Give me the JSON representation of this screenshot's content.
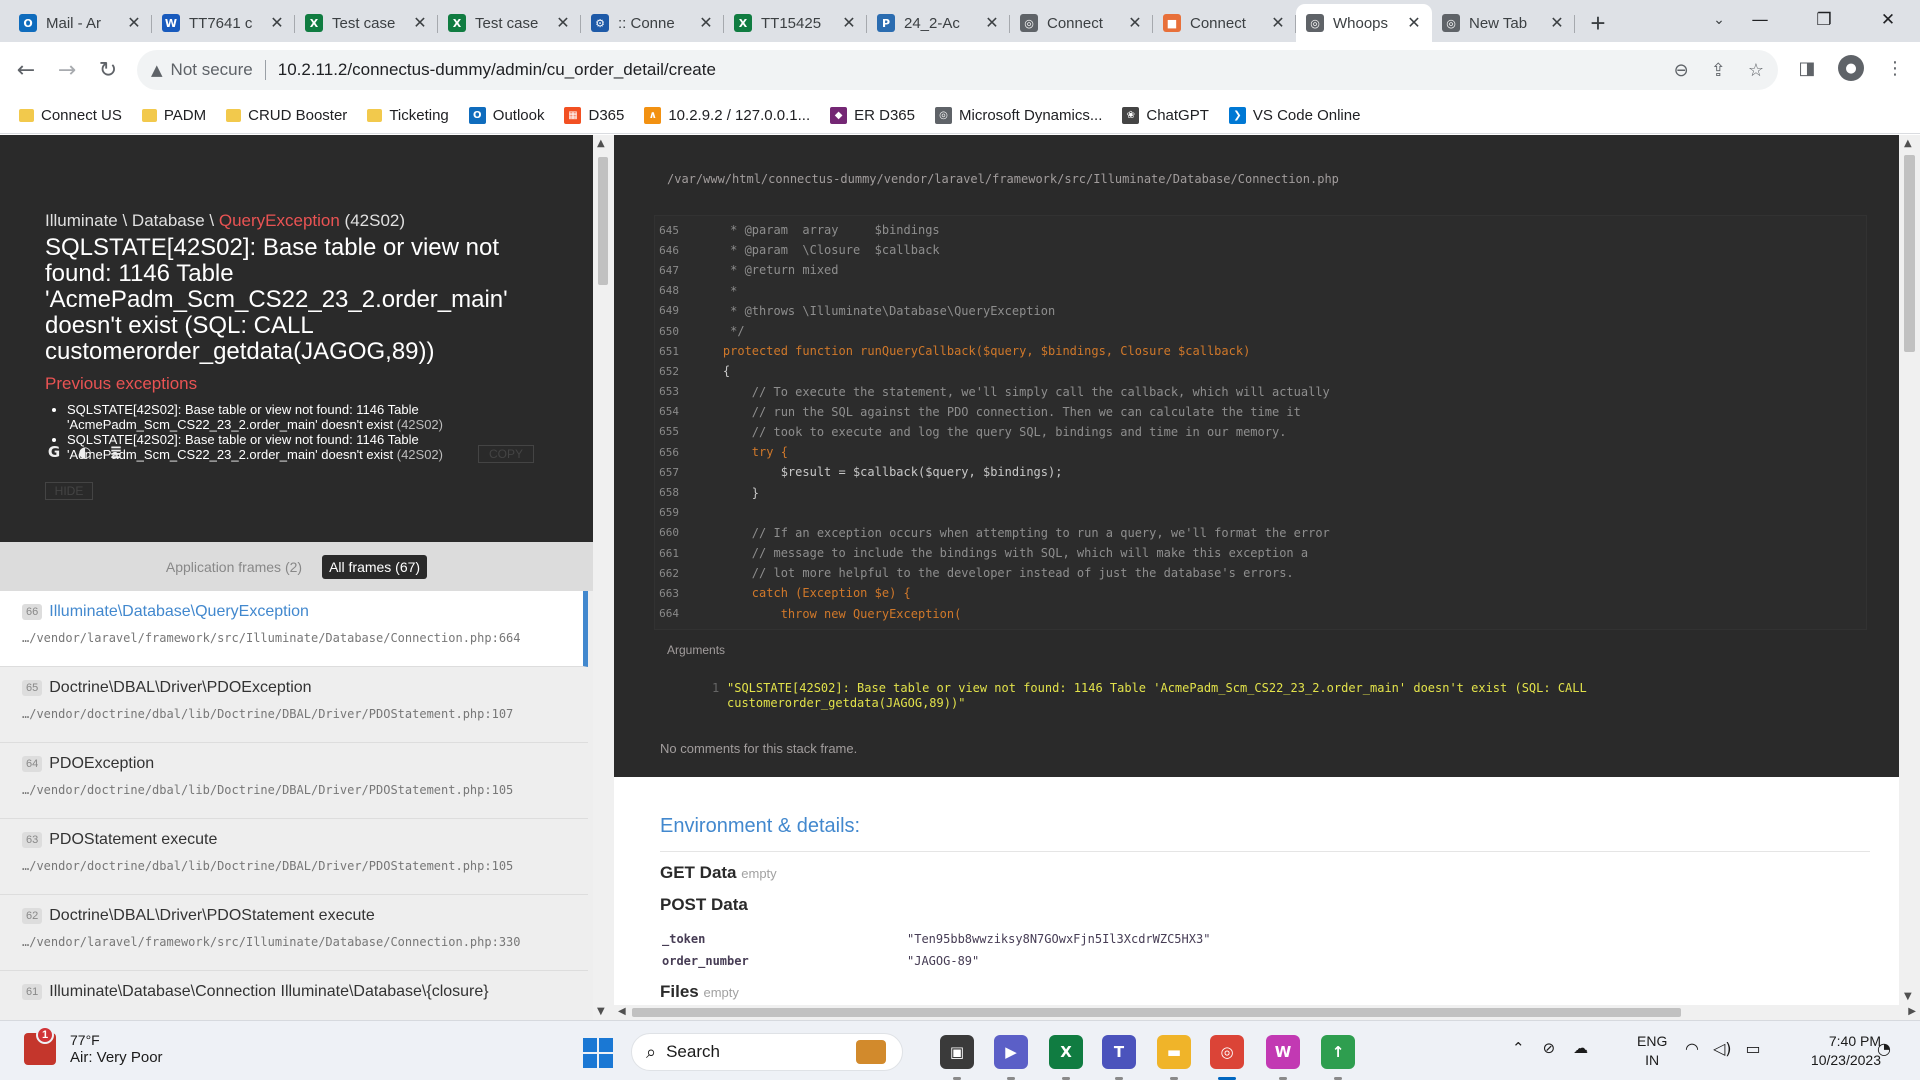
{
  "browser": {
    "tabs": [
      {
        "title": "Mail - Ar",
        "icon": "outlook-icon",
        "color": "#0f6cbd",
        "glyph": "O"
      },
      {
        "title": "TT7641 c",
        "icon": "word-icon",
        "color": "#185abd",
        "glyph": "W"
      },
      {
        "title": "Test case",
        "icon": "excel-icon",
        "color": "#107c41",
        "glyph": "X"
      },
      {
        "title": "Test case",
        "icon": "excel-icon",
        "color": "#107c41",
        "glyph": "X"
      },
      {
        "title": ":: Conne",
        "icon": "settings-icon",
        "color": "#1e5aa8",
        "glyph": "⚙"
      },
      {
        "title": "TT15425",
        "icon": "excel-icon",
        "color": "#107c41",
        "glyph": "X"
      },
      {
        "title": "24_2-Ac",
        "icon": "project-icon",
        "color": "#2b6cb0",
        "glyph": "P"
      },
      {
        "title": "Connect",
        "icon": "globe-icon",
        "color": "#5f6368",
        "glyph": "◎"
      },
      {
        "title": "Connect",
        "icon": "page-icon",
        "color": "#e8703a",
        "glyph": "■"
      },
      {
        "title": "Whoops",
        "icon": "globe-icon",
        "color": "#5f6368",
        "glyph": "◎",
        "active": true
      },
      {
        "title": "New Tab",
        "icon": "chrome-icon",
        "color": "#5f6368",
        "glyph": "◎"
      }
    ],
    "address": {
      "security": "Not secure",
      "url": "10.2.11.2/connectus-dummy/admin/cu_order_detail/create"
    },
    "bookmarks": [
      {
        "label": "Connect US",
        "type": "folder"
      },
      {
        "label": "PADM",
        "type": "folder"
      },
      {
        "label": "CRUD Booster",
        "type": "folder"
      },
      {
        "label": "Ticketing",
        "type": "folder"
      },
      {
        "label": "Outlook",
        "type": "outlook",
        "color": "#0f6cbd",
        "glyph": "O"
      },
      {
        "label": "D365",
        "type": "ms",
        "color": "#f25022",
        "glyph": "▦"
      },
      {
        "label": "10.2.9.2 / 127.0.0.1...",
        "type": "pma",
        "color": "#f29111",
        "glyph": "∧"
      },
      {
        "label": "ER D365",
        "type": "power",
        "color": "#742774",
        "glyph": "◆"
      },
      {
        "label": "Microsoft Dynamics...",
        "type": "globe",
        "color": "#5f6368",
        "glyph": "◎"
      },
      {
        "label": "ChatGPT",
        "type": "chatgpt",
        "color": "#444444",
        "glyph": "❀"
      },
      {
        "label": "VS Code Online",
        "type": "vscode",
        "color": "#0078d4",
        "glyph": "❯"
      }
    ]
  },
  "exception": {
    "namespace": "Illuminate \\ Database \\ ",
    "class": "QueryException",
    "code": " (42S02)",
    "message": "SQLSTATE[42S02]: Base table or view not found: 1146 Table 'AcmePadm_Scm_CS22_23_2.order_main' doesn't exist (SQL: CALL customerorder_getdata(JAGOG,89))",
    "previous_title": "Previous exceptions",
    "previous": [
      {
        "text": "SQLSTATE[42S02]: Base table or view not found: 1146 Table 'AcmePadm_Scm_CS22_23_2.order_main' doesn't exist ",
        "code": "(42S02)"
      },
      {
        "text": "SQLSTATE[42S02]: Base table or view not found: 1146 Table 'AcmePadm_Scm_CS22_23_2.order_main' doesn't exist ",
        "code": "(42S02)"
      }
    ],
    "copy_label": "COPY",
    "hide_label": "HIDE"
  },
  "frames_filter": {
    "application": "Application frames (2)",
    "all": "All frames (67)"
  },
  "frames": [
    {
      "index": "66",
      "class": "Illuminate\\Database\\QueryException",
      "file": "…/vendor/laravel/framework/src/Illuminate/Database/Connection.php:664",
      "active": true
    },
    {
      "index": "65",
      "class": "Doctrine\\DBAL\\Driver\\PDOException",
      "file": "…/vendor/doctrine/dbal/lib/Doctrine/DBAL/Driver/PDOStatement.php:107"
    },
    {
      "index": "64",
      "class": "PDOException",
      "file": "…/vendor/doctrine/dbal/lib/Doctrine/DBAL/Driver/PDOStatement.php:105"
    },
    {
      "index": "63",
      "class": "PDOStatement execute",
      "file": "…/vendor/doctrine/dbal/lib/Doctrine/DBAL/Driver/PDOStatement.php:105"
    },
    {
      "index": "62",
      "class": "Doctrine\\DBAL\\Driver\\PDOStatement execute",
      "file": "…/vendor/laravel/framework/src/Illuminate/Database/Connection.php:330"
    },
    {
      "index": "61",
      "class": "Illuminate\\Database\\Connection Illuminate\\Database\\{closure}",
      "file": ""
    }
  ],
  "code": {
    "path": "/var/www/html/connectus-dummy/vendor/laravel/framework/src/Illuminate/Database/Connection.php",
    "lines": [
      {
        "n": "645",
        "t": "     * @param  array     $bindings",
        "k": "comment"
      },
      {
        "n": "646",
        "t": "     * @param  \\Closure  $callback",
        "k": "comment"
      },
      {
        "n": "647",
        "t": "     * @return mixed",
        "k": "comment"
      },
      {
        "n": "648",
        "t": "     *",
        "k": "comment"
      },
      {
        "n": "649",
        "t": "     * @throws \\Illuminate\\Database\\QueryException",
        "k": "comment"
      },
      {
        "n": "650",
        "t": "     */",
        "k": "comment"
      },
      {
        "n": "651",
        "t": "    protected function runQueryCallback($query, $bindings, Closure $callback)",
        "k": "keyword"
      },
      {
        "n": "652",
        "t": "    {",
        "k": ""
      },
      {
        "n": "653",
        "t": "        // To execute the statement, we'll simply call the callback, which will actually",
        "k": "comment"
      },
      {
        "n": "654",
        "t": "        // run the SQL against the PDO connection. Then we can calculate the time it",
        "k": "comment"
      },
      {
        "n": "655",
        "t": "        // took to execute and log the query SQL, bindings and time in our memory.",
        "k": "comment"
      },
      {
        "n": "656",
        "t": "        try {",
        "k": "keyword"
      },
      {
        "n": "657",
        "t": "            $result = $callback($query, $bindings);",
        "k": ""
      },
      {
        "n": "658",
        "t": "        }",
        "k": ""
      },
      {
        "n": "659",
        "t": "",
        "k": ""
      },
      {
        "n": "660",
        "t": "        // If an exception occurs when attempting to run a query, we'll format the error",
        "k": "comment"
      },
      {
        "n": "661",
        "t": "        // message to include the bindings with SQL, which will make this exception a",
        "k": "comment"
      },
      {
        "n": "662",
        "t": "        // lot more helpful to the developer instead of just the database's errors.",
        "k": "comment"
      },
      {
        "n": "663",
        "t": "        catch (Exception $e) {",
        "k": "keyword"
      },
      {
        "n": "664",
        "t": "            throw new QueryException(",
        "k": "keyword"
      }
    ],
    "arguments_title": "Arguments",
    "argument_index": "1",
    "argument_value": "\"SQLSTATE[42S02]: Base table or view not found: 1146 Table 'AcmePadm_Scm_CS22_23_2.order_main' doesn't exist (SQL: CALL customerorder_getdata(JAGOG,89))\"",
    "no_comments": "No comments for this stack frame."
  },
  "environment": {
    "title": "Environment & details:",
    "get_label": "GET Data",
    "get_empty": "empty",
    "post_label": "POST Data",
    "post_rows": [
      {
        "key": "_token",
        "value": "\"Ten95bb8wwziksy8N7GOwxFjn5Il3XcdrWZC5HX3\""
      },
      {
        "key": "order_number",
        "value": "\"JAGOG-89\""
      }
    ],
    "files_label": "Files",
    "files_empty": "empty"
  },
  "taskbar": {
    "weather_temp": "77°F",
    "weather_desc": "Air: Very Poor",
    "weather_badge": "1",
    "search_label": "Search",
    "apps": [
      {
        "name": "task-view-app",
        "color": "#3a3a3a",
        "glyph": "▣"
      },
      {
        "name": "meet-app",
        "color": "#5b5fc7",
        "glyph": "▶"
      },
      {
        "name": "excel-app",
        "color": "#107c41",
        "glyph": "X"
      },
      {
        "name": "teams-app",
        "color": "#4b53bc",
        "glyph": "T"
      },
      {
        "name": "file-explorer-app",
        "color": "#f0b429",
        "glyph": "▬"
      },
      {
        "name": "chrome-app",
        "color": "#db4437",
        "glyph": "◎",
        "active": true
      },
      {
        "name": "pinned-app",
        "color": "#c239b3",
        "glyph": "W"
      },
      {
        "name": "store-app",
        "color": "#2e9e4f",
        "glyph": "↑"
      }
    ],
    "lang_top": "ENG",
    "lang_bottom": "IN",
    "time": "7:40 PM",
    "date": "10/23/2023"
  }
}
